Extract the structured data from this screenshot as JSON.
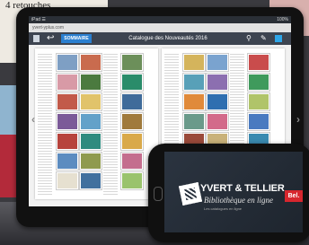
{
  "background": {
    "paper_title": "4 retouches",
    "colors": {
      "red": "#b32a3a",
      "blue": "#8fb4cf",
      "pink": "#d8b0ad"
    }
  },
  "tablet": {
    "status": {
      "left": "iPad ☰",
      "right": "100%"
    },
    "url": "yvert-yplus.com",
    "toolbar": {
      "sommaire_label": "SOMMAIRE",
      "title": "Catalogue des Nouveautés 2016",
      "accent": "#2a7fd0"
    },
    "icons": {
      "grid": "grid-icon",
      "back": "back-arrow-icon",
      "search": "search-icon",
      "share": "share-icon",
      "list": "list-icon",
      "prev": "chevron-left-icon",
      "next": "chevron-right-icon",
      "home": "back-icon"
    }
  },
  "phone": {
    "brand": "YVERT & TELLIER",
    "tagline": "Bibliothèque en ligne",
    "subline": "Les catalogues en ligne",
    "badge": "Bel.",
    "badge_color": "#d7262e"
  }
}
